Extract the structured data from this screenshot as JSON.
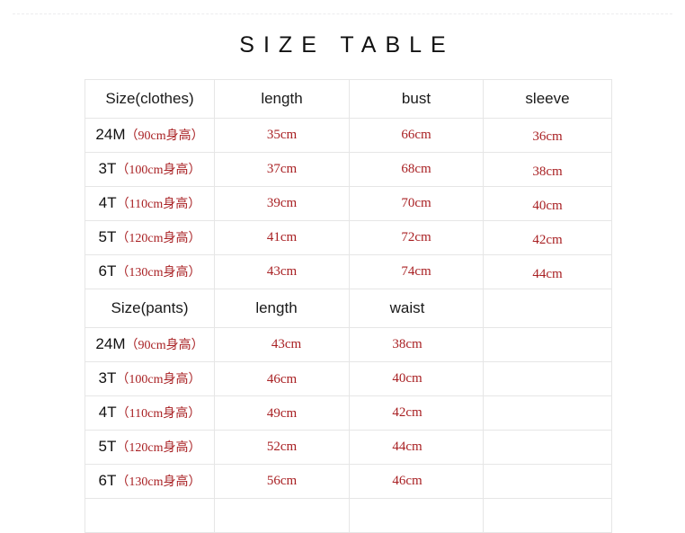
{
  "title": "SIZE TABLE",
  "colors": {
    "value_red": "#a81f22",
    "text_black": "#111111",
    "grid_line": "#e6e6e6",
    "background": "#ffffff"
  },
  "table": {
    "sections": [
      {
        "header": {
          "size_label": "Size(clothes)",
          "col1": "length",
          "col2": "bust",
          "col3": "sleeve"
        },
        "rows": [
          {
            "code": "24M",
            "note": "（90cm身高）",
            "col1": "35cm",
            "col2": "66cm",
            "col3": "36cm"
          },
          {
            "code": "3T",
            "note": "（100cm身高）",
            "col1": "37cm",
            "col2": "68cm",
            "col3": "38cm"
          },
          {
            "code": "4T",
            "note": "（110cm身高）",
            "col1": "39cm",
            "col2": "70cm",
            "col3": "40cm"
          },
          {
            "code": "5T",
            "note": "（120cm身高）",
            "col1": "41cm",
            "col2": "72cm",
            "col3": "42cm"
          },
          {
            "code": "6T",
            "note": "（130cm身高）",
            "col1": "43cm",
            "col2": "74cm",
            "col3": "44cm"
          }
        ]
      },
      {
        "header": {
          "size_label": "Size(pants)",
          "col1": "length",
          "col2": "waist",
          "col3": ""
        },
        "rows": [
          {
            "code": "24M",
            "note": "（90cm身高）",
            "col1": "43cm",
            "col2": "38cm",
            "col3": ""
          },
          {
            "code": "3T",
            "note": "（100cm身高）",
            "col1": "46cm",
            "col2": "40cm",
            "col3": ""
          },
          {
            "code": "4T",
            "note": "（110cm身高）",
            "col1": "49cm",
            "col2": "42cm",
            "col3": ""
          },
          {
            "code": "5T",
            "note": "（120cm身高）",
            "col1": "52cm",
            "col2": "44cm",
            "col3": ""
          },
          {
            "code": "6T",
            "note": "（130cm身高）",
            "col1": "56cm",
            "col2": "46cm",
            "col3": ""
          }
        ]
      }
    ],
    "trailing_empty_row": {
      "c0": "",
      "c1": "",
      "c2": "",
      "c3": ""
    }
  }
}
